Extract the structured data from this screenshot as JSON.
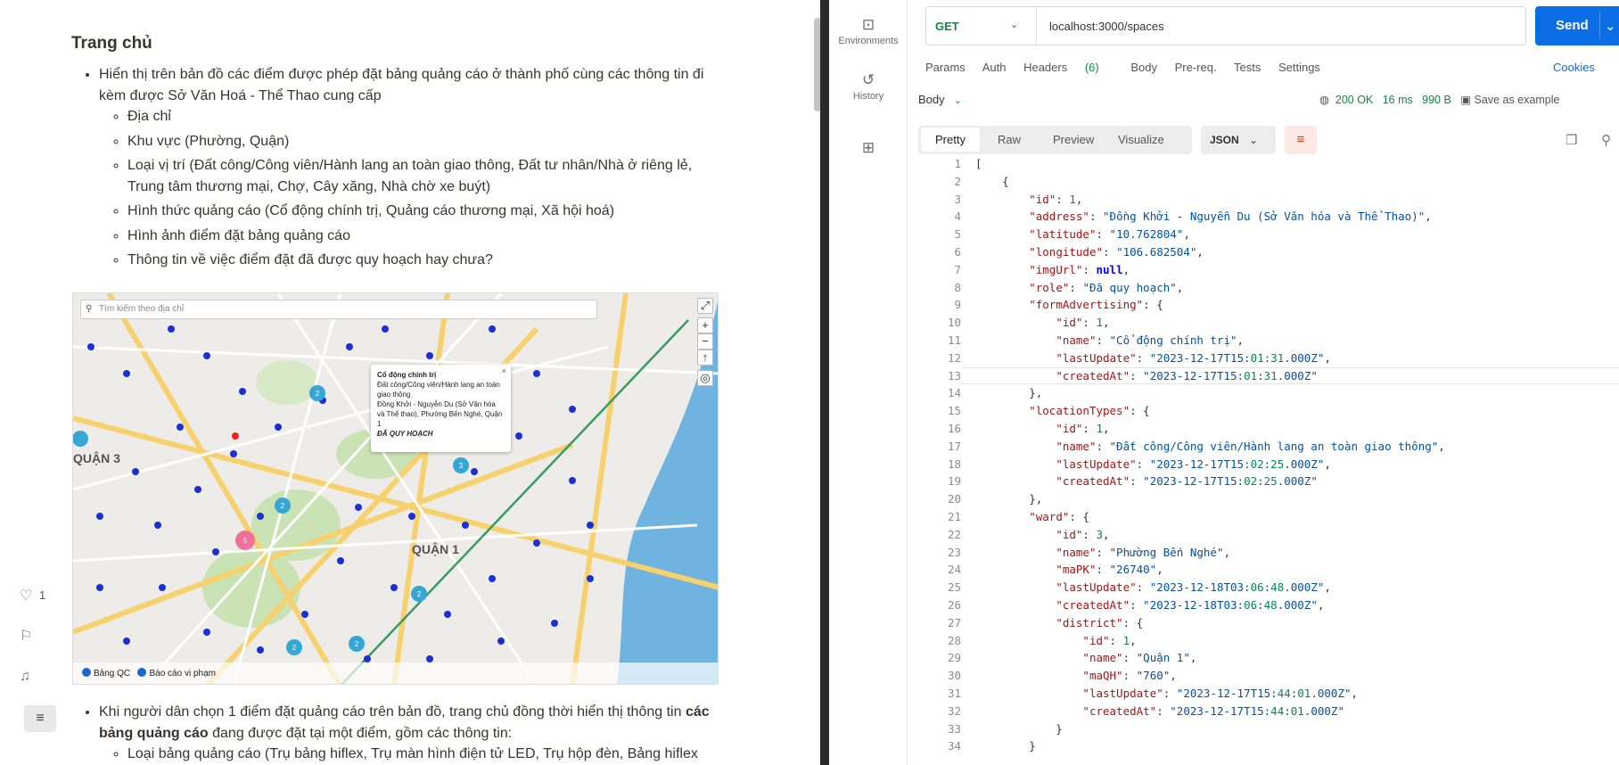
{
  "doc": {
    "heading": "Trang chủ",
    "bullet1": "Hiển thị trên bản đồ các điểm được phép đặt bảng quảng cáo ở thành phố cùng các thông tin đi kèm được Sở Văn Hoá - Thể Thao cung cấp",
    "sub1": [
      "Địa chỉ",
      "Khu vực (Phường, Quận)",
      "Loại vị trí (Đất công/Công viên/Hành lang an toàn giao thông, Đất tư nhân/Nhà ở riêng lẻ, Trung tâm thương mại, Chợ, Cây xăng, Nhà chờ xe buýt)",
      "Hình thức quảng cáo (Cổ động chính trị, Quảng cáo thương mại, Xã hội hoá)",
      "Hình ảnh điểm đặt bảng quảng cáo",
      "Thông tin về việc điểm đặt đã được quy hoạch hay chưa?"
    ],
    "bullet2_pre": "Khi người dân chọn 1 điểm đặt quảng cáo trên bản đồ, trang chủ đồng thời hiển thị thông tin ",
    "bullet2_bold": "các bảng quảng cáo",
    "bullet2_post": " đang được đặt tại một điểm, gồm các thông tin:",
    "sub2_first": "Loại bảng quảng cáo (Trụ bảng hiflex, Trụ màn hình điện tử LED, Trụ hộp đèn, Bảng hiflex",
    "like_count": "1"
  },
  "map": {
    "search_placeholder": "Tìm kiếm theo địa chỉ",
    "popup_title": "Cổ động chính trị",
    "popup_line1": "Đất công/Công viên/Hành lang an toàn giao thông",
    "popup_line2": "Đồng Khởi - Nguyễn Du (Sở Văn hóa và Thể thao), Phường Bến Nghé, Quận 1",
    "popup_status": "ĐÃ QUY HOẠCH",
    "label_q1": "QUẬN 1",
    "label_q3": "QUẬN 3",
    "legend1": "Bảng QC",
    "legend2": "Báo cáo vi phạm"
  },
  "postman": {
    "rail": [
      "Environments",
      "History"
    ],
    "method": "GET",
    "url": "localhost:3000/spaces",
    "send": "Send",
    "tabs": [
      "Params",
      "Auth",
      "Headers",
      "(6)",
      "Body",
      "Pre-req.",
      "Tests",
      "Settings"
    ],
    "cookies": "Cookies",
    "body_label": "Body",
    "status": "200 OK",
    "time": "16 ms",
    "size": "990 B",
    "save": "Save as example",
    "views": [
      "Pretty",
      "Raw",
      "Preview",
      "Visualize"
    ],
    "format": "JSON"
  },
  "code": [
    "[",
    "    {",
    "        \"id\": 1,",
    "        \"address\": \"Đồng Khởi - Nguyễn Du (Sở Văn hóa và Thể Thao)\",",
    "        \"latitude\": \"10.762804\",",
    "        \"longitude\": \"106.682504\",",
    "        \"imgUrl\": null,",
    "        \"role\": \"Đã quy hoạch\",",
    "        \"formAdvertising\": {",
    "            \"id\": 1,",
    "            \"name\": \"Cổ động chính trị\",",
    "            \"lastUpdate\": \"2023-12-17T15:01:31.000Z\",",
    "            \"createdAt\": \"2023-12-17T15:01:31.000Z\"",
    "        },",
    "        \"locationTypes\": {",
    "            \"id\": 1,",
    "            \"name\": \"Đất công/Công viên/Hành lang an toàn giao thông\",",
    "            \"lastUpdate\": \"2023-12-17T15:02:25.000Z\",",
    "            \"createdAt\": \"2023-12-17T15:02:25.000Z\"",
    "        },",
    "        \"ward\": {",
    "            \"id\": 3,",
    "            \"name\": \"Phường Bến Nghé\",",
    "            \"maPK\": \"26740\",",
    "            \"lastUpdate\": \"2023-12-18T03:06:48.000Z\",",
    "            \"createdAt\": \"2023-12-18T03:06:48.000Z\",",
    "            \"district\": {",
    "                \"id\": 1,",
    "                \"name\": \"Quận 1\",",
    "                \"maQH\": \"760\",",
    "                \"lastUpdate\": \"2023-12-17T15:44:01.000Z\",",
    "                \"createdAt\": \"2023-12-17T15:44:01.000Z\"",
    "            }",
    "        }"
  ]
}
